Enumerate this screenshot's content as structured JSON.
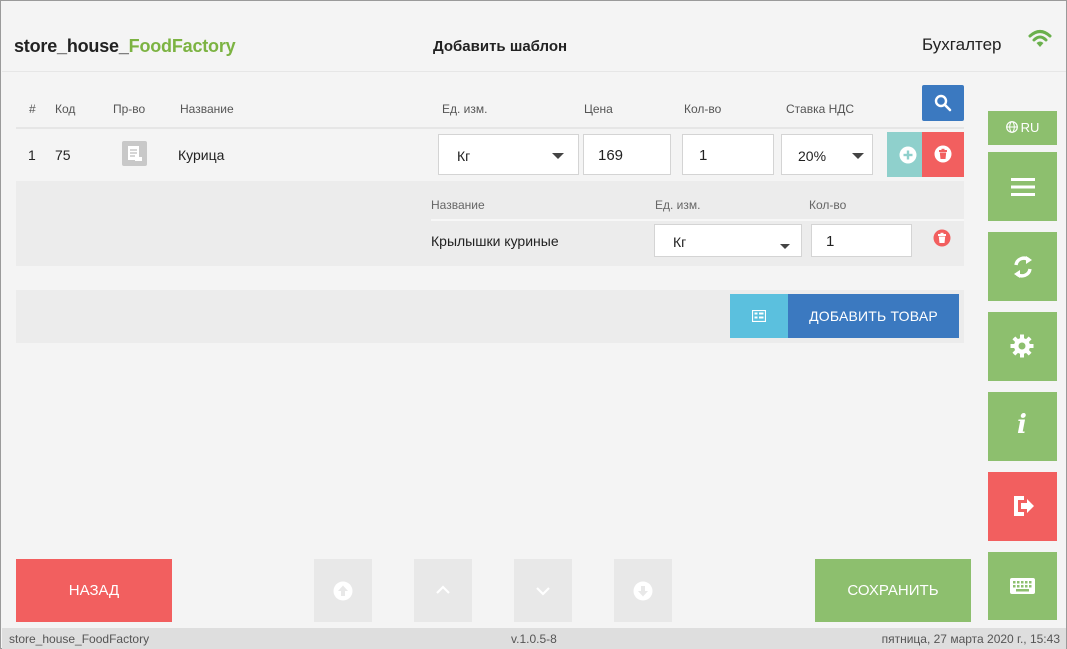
{
  "header": {
    "app_title_prefix": "store_house_",
    "app_title_brand": "FoodFactory",
    "page_title": "Добавить шаблон",
    "user_name": "Бухгалтер"
  },
  "table": {
    "headers": [
      "#",
      "Код",
      "Пр-во",
      "Название",
      "Ед. изм.",
      "Цена",
      "Кол-во",
      "Ставка НДС"
    ],
    "rows": [
      {
        "num": "1",
        "code": "75",
        "name": "Курица",
        "unit": "Кг",
        "price": "169",
        "qty": "1",
        "vat": "20%",
        "components": {
          "headers": [
            "Название",
            "Ед. изм.",
            "Кол-во"
          ],
          "items": [
            {
              "name": "Крылышки куриные",
              "unit": "Кг",
              "qty": "1"
            }
          ]
        }
      }
    ]
  },
  "add_product_label": "ДОБАВИТЬ ТОВАР",
  "bottom": {
    "back_label": "НАЗАД",
    "save_label": "СОХРАНИТЬ"
  },
  "sidebar": {
    "lang_label": "RU"
  },
  "footer": {
    "left": "store_house_FoodFactory",
    "version": "v.1.0.5-8",
    "datetime": "пятница, 27 марта 2020 г., 15:43"
  },
  "colors": {
    "green": "#8dbf6e",
    "red": "#f25f5f",
    "blue": "#3b79c0",
    "teal": "#8fd0cc",
    "cyan": "#5bc0de",
    "brand_green": "#7cb342"
  },
  "icons": {
    "search": "search-icon",
    "wifi": "wifi-icon",
    "plus": "plus-circle-icon",
    "trash": "trash-icon",
    "menu": "menu-icon",
    "sync": "sync-icon",
    "settings": "gear-icon",
    "info": "info-icon",
    "logout": "logout-icon",
    "keyboard": "keyboard-icon",
    "globe": "globe-icon"
  }
}
